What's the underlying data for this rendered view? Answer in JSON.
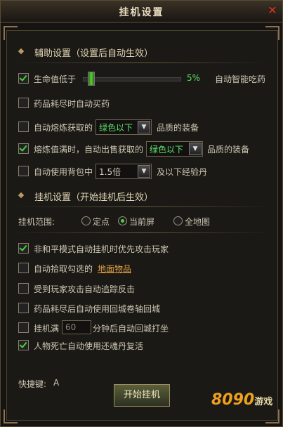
{
  "window": {
    "title": "挂机设置",
    "close_icon": "✕"
  },
  "assist": {
    "header": "辅助设置（设置后自动生效）",
    "hp_label": "生命值低于",
    "hp_percent": "5%",
    "hp_level": 0.05,
    "hp_suffix": "自动智能吃药",
    "auto_buy": "药品耗尽时自动买药",
    "smelt_label": "自动熔炼获取的",
    "smelt_select": "绿色以下",
    "smelt_suffix": "品质的装备",
    "sell_label": "熔炼值满时，自动出售获取的",
    "sell_select": "绿色以下",
    "sell_suffix": "品质的装备",
    "exp_label": "自动使用背包中",
    "exp_select": "1.5倍",
    "exp_suffix": "及以下经验丹"
  },
  "hook": {
    "header": "挂机设置（开始挂机后生效）",
    "range_label": "挂机范围:",
    "range_options": [
      "定点",
      "当前屏",
      "全地图"
    ],
    "opt1": "非和平模式自动挂机时优先攻击玩家",
    "opt2_prefix": "自动拾取勾选的",
    "opt2_link": "地面物品",
    "opt3": "受到玩家攻击自动追踪反击",
    "opt4": "药品耗尽后自动使用回城卷轴回城",
    "opt5_prefix": "挂机满",
    "opt5_minutes_placeholder": "60",
    "opt5_suffix": "分钟后自动回城打坐",
    "opt6": "人物死亡自动使用还魂丹复活"
  },
  "footer": {
    "hotkey_label": "快捷键:",
    "hotkey_value": "A",
    "start_button": "开始挂机",
    "watermark_brand": "8090",
    "watermark_text": "游戏"
  }
}
